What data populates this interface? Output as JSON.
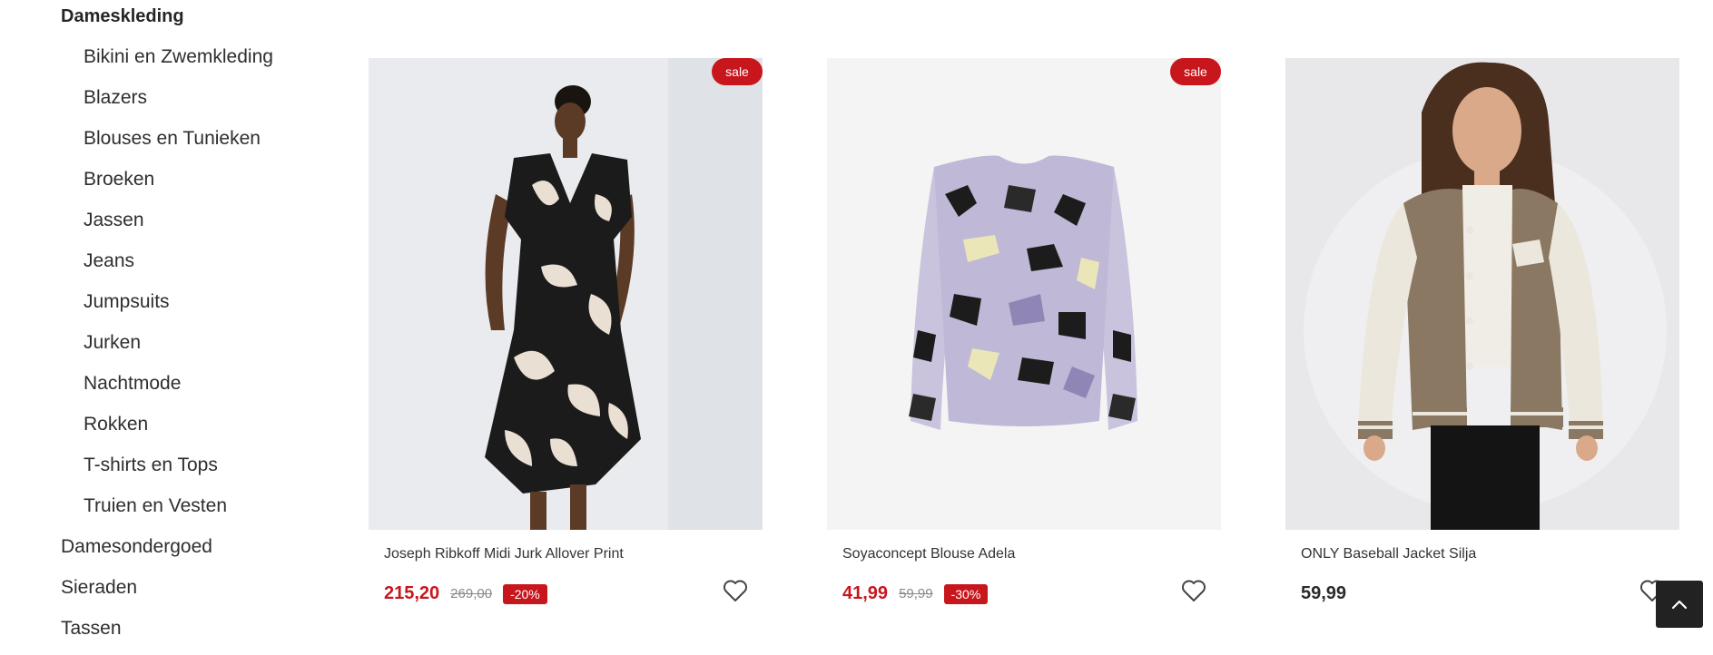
{
  "sidebar": {
    "heading": "Dameskleding",
    "subcategories": [
      "Bikini en Zwemkleding",
      "Blazers",
      "Blouses en Tunieken",
      "Broeken",
      "Jassen",
      "Jeans",
      "Jumpsuits",
      "Jurken",
      "Nachtmode",
      "Rokken",
      "T-shirts en Tops",
      "Truien en Vesten"
    ],
    "categories": [
      "Damesondergoed",
      "Sieraden",
      "Tassen"
    ]
  },
  "products": [
    {
      "name": "Joseph Ribkoff Midi Jurk Allover Print",
      "price": "215,20",
      "old_price": "269,00",
      "discount": "-20%",
      "badge": "sale",
      "image_icon": "black-white-print-dress-image"
    },
    {
      "name": "Soyaconcept Blouse Adela",
      "price": "41,99",
      "old_price": "59,99",
      "discount": "-30%",
      "badge": "sale",
      "image_icon": "floral-blouse-image"
    },
    {
      "name": "ONLY Baseball Jacket Silja",
      "price": "59,99",
      "image_icon": "baseball-jacket-image"
    }
  ],
  "icons": {
    "wishlist": "heart-icon",
    "scroll_top": "chevron-up-icon"
  },
  "colors": {
    "accent": "#c8161d",
    "scroll_button": "#222222"
  }
}
